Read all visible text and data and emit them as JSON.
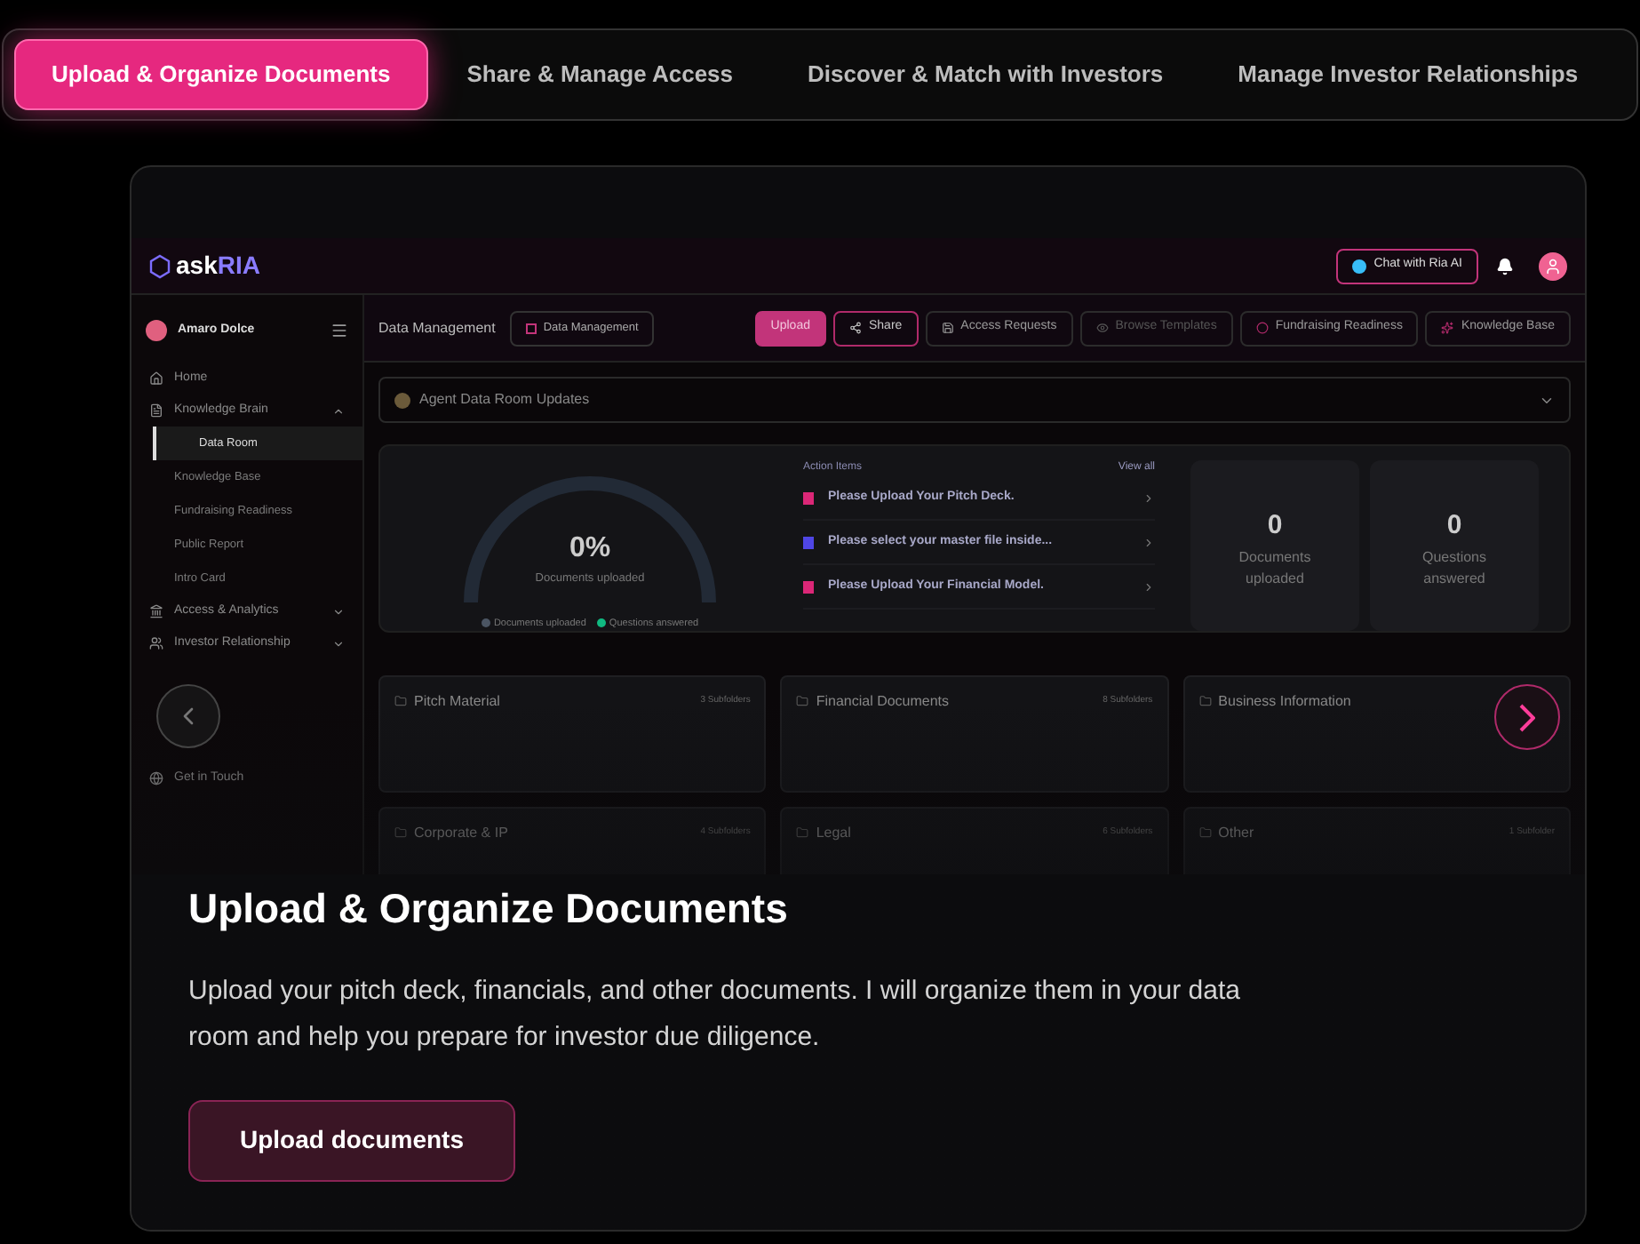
{
  "tabs": [
    {
      "label": "Upload & Organize Documents",
      "selected": true
    },
    {
      "label": "Share & Manage Access",
      "selected": false
    },
    {
      "label": "Discover & Match with Investors",
      "selected": false
    },
    {
      "label": "Manage Investor Relationships",
      "selected": false
    }
  ],
  "app": {
    "logo_text": "ask",
    "logo_accent": "RIA",
    "chat_button": "Chat with Ria AI",
    "user_name": "Amaro Dolce",
    "sidebar": [
      {
        "label": "Home"
      },
      {
        "label": "Knowledge Brain",
        "expanded": true,
        "children": [
          {
            "label": "Data Room",
            "selected": true
          },
          {
            "label": "Knowledge Base",
            "selected": false
          },
          {
            "label": "Fundraising Readiness",
            "selected": false
          },
          {
            "label": "Public Report",
            "selected": false
          },
          {
            "label": "Intro Card",
            "selected": false
          }
        ]
      },
      {
        "label": "Access & Analytics",
        "expanded": false
      },
      {
        "label": "Investor Relationship",
        "expanded": false
      },
      {
        "label": "Get in Touch"
      }
    ],
    "page_title": "Data Management",
    "breadcrumb": "Data Management",
    "toolbar": [
      {
        "label": "Upload",
        "kind": "primary"
      },
      {
        "label": "Share",
        "kind": "outline"
      },
      {
        "label": "Access Requests",
        "kind": "plain"
      },
      {
        "label": "Browse Templates",
        "kind": "disabled"
      },
      {
        "label": "Fundraising Readiness",
        "kind": "plain"
      },
      {
        "label": "Knowledge Base",
        "kind": "plain"
      }
    ],
    "updates_dropdown": "Agent Data Room Updates",
    "gauge": {
      "value": "0%",
      "caption": "Documents uploaded",
      "legend": [
        {
          "label": "Documents uploaded",
          "color": "#4b5563"
        },
        {
          "label": "Questions answered",
          "color": "#10b981"
        }
      ]
    },
    "action_items": {
      "title": "Action Items",
      "view_all": "View all",
      "items": [
        {
          "label": "Please Upload Your Pitch Deck.",
          "color": "#db2777"
        },
        {
          "label": "Please select your master file inside...",
          "color": "#4f46e5"
        },
        {
          "label": "Please Upload Your Financial Model.",
          "color": "#db2777"
        }
      ]
    },
    "stats": [
      {
        "value": "0",
        "label": "Documents uploaded"
      },
      {
        "value": "0",
        "label": "Questions answered"
      }
    ],
    "folders": [
      {
        "name": "Pitch Material",
        "count": "3 Subfolders"
      },
      {
        "name": "Financial Documents",
        "count": "8 Subfolders"
      },
      {
        "name": "Business Information"
      },
      {
        "name": "Corporate & IP",
        "count": "4 Subfolders"
      },
      {
        "name": "Legal",
        "count": "6 Subfolders"
      },
      {
        "name": "Other",
        "count": "1 Subfolder"
      }
    ]
  },
  "hero": {
    "title": "Upload & Organize Documents",
    "description": "Upload your pitch deck, financials, and other documents. I will organize them in your data room and help you prepare for investor due diligence.",
    "button": "Upload documents"
  }
}
